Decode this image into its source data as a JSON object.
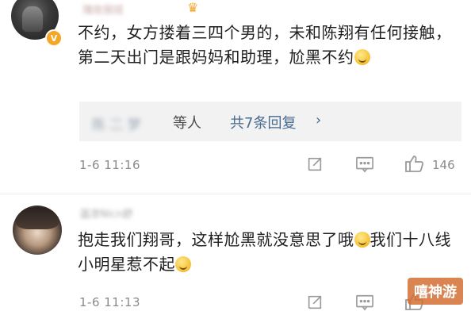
{
  "comments": [
    {
      "username": "瑰玫丽班",
      "verified_badge": "V",
      "text": "不约，女方搂着三四个男的，未和陈翔有任何接触，第二天出门是跟妈妈和助理，尬黑不约",
      "replies": {
        "blurred_names": "陈 二 梦",
        "suffix": "等人",
        "total": "共7条回复",
        "chevron": "›"
      },
      "time": "1-6 11:16",
      "likes": "146"
    },
    {
      "username": "温凉Nlcn舒",
      "text_line1": "抱走我们翔哥，这样尬黑就没意思了哦",
      "text_line2_a": "我们十八线小明星惹不起",
      "time": "1-6 11:13"
    }
  ],
  "icons": {
    "share": "share-icon",
    "comment": "comment-icon",
    "like": "thumbs-up-icon",
    "crown": "crown-icon"
  },
  "watermark": "嘻神游"
}
